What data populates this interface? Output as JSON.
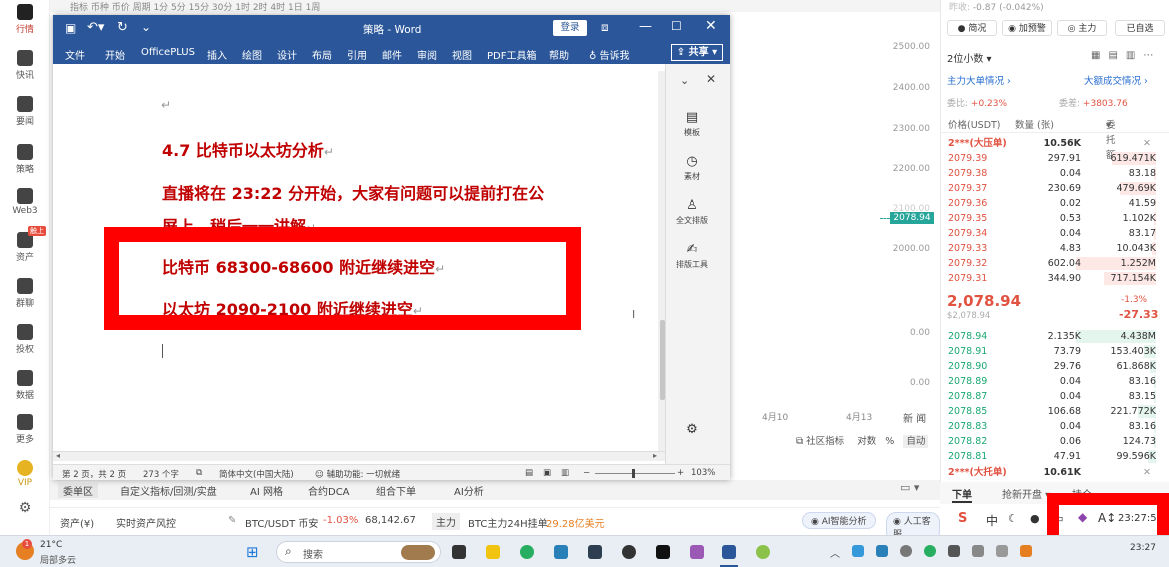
{
  "topstrip": {
    "text": "指标 币种 币价 周期 1分 5分 15分 30分 1时 2时 4时 1日 1周"
  },
  "leftbar": {
    "items": [
      {
        "label": "行情",
        "active": true
      },
      {
        "label": "快讯"
      },
      {
        "label": "要闻"
      },
      {
        "label": "策略"
      },
      {
        "label": "Web3"
      },
      {
        "label": "资产",
        "badge": "触上"
      },
      {
        "label": "群聊"
      },
      {
        "label": "投权"
      },
      {
        "label": "数据"
      },
      {
        "label": "更多"
      },
      {
        "label": "VIP"
      }
    ]
  },
  "word": {
    "title": "策略 - Word",
    "login": "登录",
    "share": "共享",
    "tabs": [
      "文件",
      "开始",
      "OfficePLUS",
      "插入",
      "绘图",
      "设计",
      "布局",
      "引用",
      "邮件",
      "审阅",
      "视图",
      "PDF工具箱",
      "帮助",
      "告诉我"
    ],
    "doc": {
      "heading": "4.7 比特币以太坊分析",
      "para1": "直播将在 23:22 分开始，大家有问题可以提前打在公",
      "para2": "屏上，稍后一一讲解",
      "btc": "比特币 68300-68600 附近继续进空",
      "eth": "以太坊 2090-2100 附近继续进空"
    },
    "side": [
      "模板",
      "素材",
      "全文排版",
      "排版工具"
    ],
    "status": {
      "page": "第 2 页，共 2 页",
      "words": "273 个字",
      "lang": "简体中文(中国大陆)",
      "access": "辅助功能: 一切就绪",
      "zoom": "103%"
    }
  },
  "chart": {
    "axis": [
      "2500.00",
      "2400.00",
      "2300.00",
      "2200.00",
      "2100.00",
      "2000.00",
      "0.00",
      "0.00"
    ],
    "price_tag": "2078.94",
    "dates": [
      "4月10",
      "4月13"
    ],
    "tools": [
      "社区指标",
      "对数",
      "%",
      "自动"
    ],
    "ticker": "新 闻"
  },
  "book": {
    "top_change": "-0.87 (-0.042%)",
    "buttons": [
      "简况",
      "加预警",
      "主力",
      "已自选"
    ],
    "decimals": "2位小数",
    "link_left": "主力大单情况",
    "link_right": "大额成交情况",
    "ratio_left": "+0.23%",
    "ratio_right": "+3803.76",
    "ratio_left_lbl": "委比:",
    "ratio_right_lbl": "委差:",
    "headers": [
      "价格(USDT)",
      "数量 (张)",
      "委托额"
    ],
    "ask_tag": "2***(大压单)",
    "ask_tag_val": "10.56K",
    "asks": [
      [
        "2079.39",
        "297.91",
        "619.471K",
        0.55
      ],
      [
        "2079.38",
        "0.04",
        "83.18",
        0.02
      ],
      [
        "2079.37",
        "230.69",
        "479.69K",
        0.45
      ],
      [
        "2079.36",
        "0.02",
        "41.59",
        0.01
      ],
      [
        "2079.35",
        "0.53",
        "1.102K",
        0.02
      ],
      [
        "2079.34",
        "0.04",
        "83.17",
        0.02
      ],
      [
        "2079.33",
        "4.83",
        "10.043K",
        0.05
      ],
      [
        "2079.32",
        "602.04",
        "1.252M",
        1.0
      ],
      [
        "2079.31",
        "344.90",
        "717.154K",
        0.65
      ]
    ],
    "last_price": "2,078.94",
    "last_usd": "$2,078.94",
    "last_pct": "-1.3%",
    "last_chg": "-27.33",
    "bids": [
      [
        "2078.94",
        "2.135K",
        "4.438M",
        1.0
      ],
      [
        "2078.91",
        "73.79",
        "153.403K",
        0.15
      ],
      [
        "2078.90",
        "29.76",
        "61.868K",
        0.08
      ],
      [
        "2078.89",
        "0.04",
        "83.16",
        0.02
      ],
      [
        "2078.87",
        "0.04",
        "83.15",
        0.02
      ],
      [
        "2078.85",
        "106.68",
        "221.772K",
        0.22
      ],
      [
        "2078.83",
        "0.04",
        "83.16",
        0.02
      ],
      [
        "2078.82",
        "0.06",
        "124.73",
        0.02
      ],
      [
        "2078.81",
        "47.91",
        "99.596K",
        0.1
      ]
    ],
    "bid_tag": "2***(大托单)",
    "bid_tag_val": "10.61K",
    "bottom_tabs": [
      "下单",
      "抢新开盘",
      "持仓"
    ]
  },
  "bottombar": {
    "tabs": [
      "委单区",
      "自定义指标/回测/实盘",
      "AI 网格",
      "合约DCA",
      "组合下单",
      "AI分析"
    ]
  },
  "statusline": {
    "asset": "资产(¥)",
    "risk": "实时资产风控",
    "pair": "BTC/USDT 币安",
    "pct": "-1.03%",
    "price": "68,142.67",
    "main": "主力",
    "flow_label": "BTC主力24H挂单",
    "flow_val": "29.28亿美元",
    "ai": "AI智能分析",
    "service": "人工客服"
  },
  "tray": {
    "time": "23:27:52",
    "lang": "中"
  },
  "taskbar": {
    "weather_temp": "21°C",
    "weather_desc": "局部多云",
    "search": "搜索",
    "time": "23:27"
  }
}
